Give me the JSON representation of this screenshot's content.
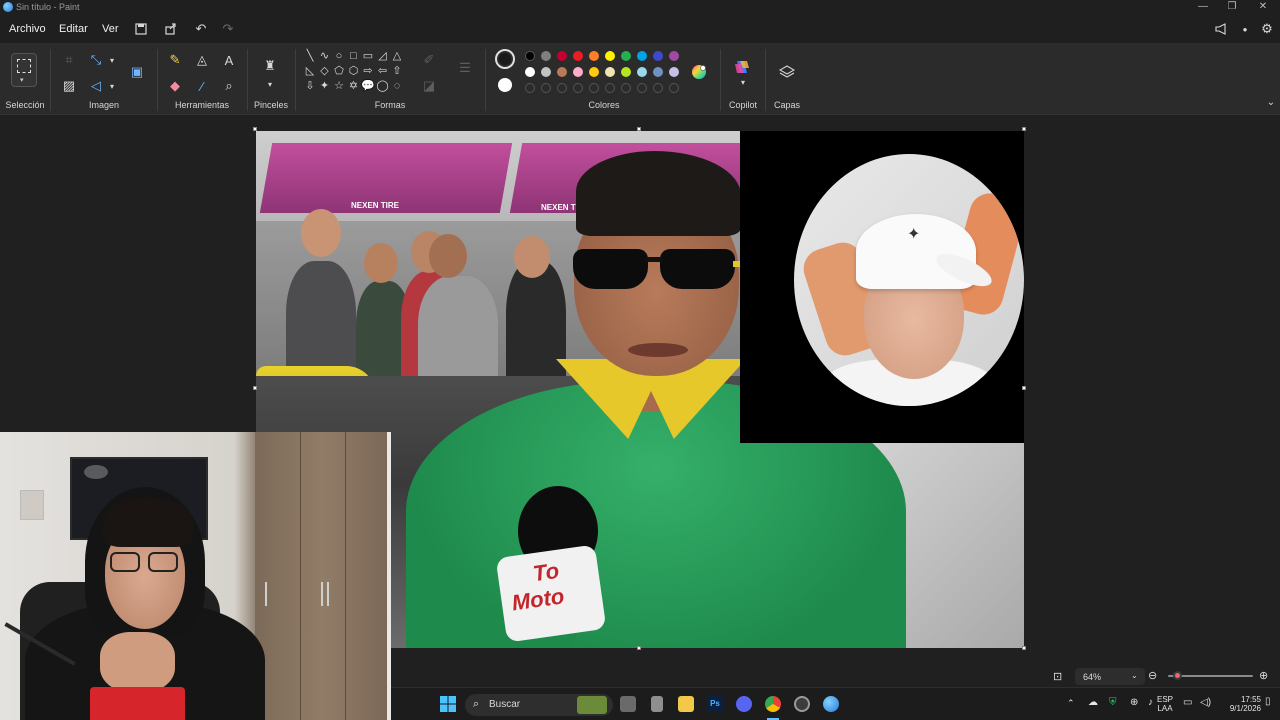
{
  "window": {
    "title": "Sin título - Paint",
    "minimize": "—",
    "maximize": "❐",
    "close": "✕"
  },
  "menu": {
    "items": [
      "Archivo",
      "Editar",
      "Ver"
    ]
  },
  "ribbon": {
    "groups": {
      "seleccion": "Selección",
      "imagen": "Imagen",
      "herramientas": "Herramientas",
      "pinceles": "Pinceles",
      "formas": "Formas",
      "colores": "Colores",
      "copilot": "Copilot",
      "capas": "Capas"
    },
    "primary_color": "#1a1a1a",
    "secondary_color": "#ffffff",
    "palette_row1": [
      "#000000",
      "#7f7f7f",
      "#c3002f",
      "#ed1c24",
      "#ff7f27",
      "#fff200",
      "#22b14c",
      "#00a2e8",
      "#3f48cc",
      "#a349a4"
    ],
    "palette_row2": [
      "#ffffff",
      "#c3c3c3",
      "#b97a57",
      "#ffaec9",
      "#ffc90e",
      "#efe4b0",
      "#b5e61d",
      "#99d9ea",
      "#7092be",
      "#c8bfe7"
    ],
    "shapes": [
      "╲",
      "∿",
      "○",
      "□",
      "▭",
      "◿",
      "△",
      "◺",
      "◇",
      "⬠",
      "⬡",
      "⇨",
      "⇦",
      "⇧",
      "⇩",
      "✦",
      "☆",
      "✡",
      "💬",
      "◯",
      "◌"
    ]
  },
  "canvas": {
    "photo_texts": {
      "tent1": "NEXEN TIRE",
      "tent2": "NEXEN TIRE",
      "mic_line1": "To",
      "mic_line2": "Moto"
    }
  },
  "status": {
    "zoom": "64%"
  },
  "taskbar": {
    "search": "Buscar",
    "lang_line1": "ESP",
    "lang_line2": "LAA",
    "time": "17:55",
    "date": "9/1/2026"
  }
}
